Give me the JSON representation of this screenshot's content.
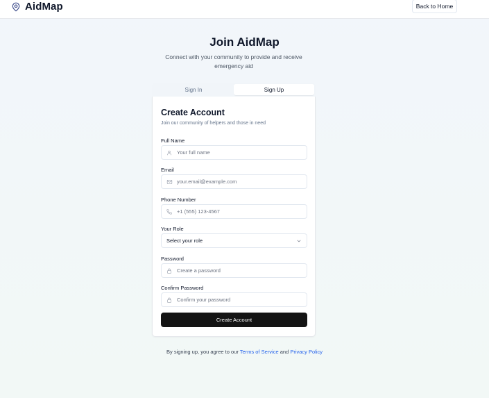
{
  "header": {
    "brand": "AidMap",
    "back_label": "Back to Home"
  },
  "intro": {
    "title": "Join AidMap",
    "subtitle": "Connect with your community to provide and receive emergency aid"
  },
  "tabs": [
    {
      "label": "Sign In",
      "active": false
    },
    {
      "label": "Sign Up",
      "active": true
    }
  ],
  "form": {
    "title": "Create Account",
    "description": "Join our community of helpers and those in need",
    "full_name": {
      "label": "Full Name",
      "placeholder": "Your full name",
      "value": "",
      "icon": "user-icon"
    },
    "email": {
      "label": "Email",
      "placeholder": "your.email@example.com",
      "value": "",
      "icon": "mail-icon"
    },
    "phone": {
      "label": "Phone Number",
      "placeholder": "+1 (555) 123-4567",
      "value": "",
      "icon": "phone-icon"
    },
    "role": {
      "label": "Your Role",
      "value": "Select your role",
      "icon": "chevron-down-icon"
    },
    "password": {
      "label": "Password",
      "placeholder": "Create a password",
      "value": "",
      "icon": "lock-icon"
    },
    "confirm_password": {
      "label": "Confirm Password",
      "placeholder": "Confirm your password",
      "value": "",
      "icon": "lock-icon"
    },
    "submit_label": "Create Account"
  },
  "legal": {
    "prefix": "By signing up, you agree to our ",
    "terms": "Terms of Service",
    "middle": " and ",
    "privacy": "Privacy Policy"
  },
  "colors": {
    "accent_link": "#2563eb",
    "primary_button": "#141414",
    "brand_icon": "#3b4a8a"
  }
}
